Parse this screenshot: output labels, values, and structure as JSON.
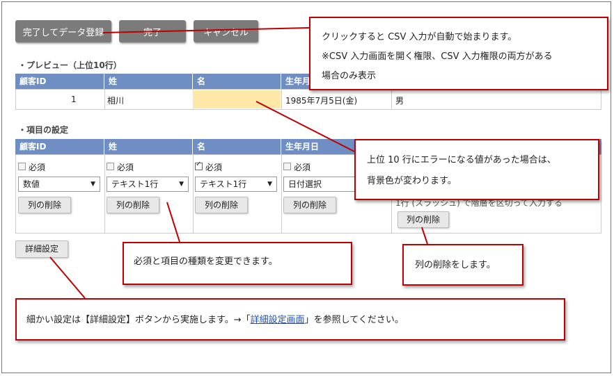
{
  "toolbar": {
    "complete_register_label": "完了してデータ登録",
    "complete_label": "完了",
    "cancel_label": "キャンセル"
  },
  "preview": {
    "title": "・プレビュー（上位10行）",
    "headers": [
      "顧客ID",
      "姓",
      "名",
      "生年月日"
    ],
    "row": [
      "1",
      "相川",
      "",
      "1985年7月5日(金)",
      "男"
    ],
    "error_cell_color": "#fde8a8"
  },
  "settings": {
    "title": "・項目の設定",
    "headers": [
      "顧客ID",
      "姓",
      "名",
      "生年月日"
    ],
    "required_label": "必須",
    "columns": [
      {
        "required": false,
        "type": "数値",
        "delete_label": "列の削除"
      },
      {
        "required": false,
        "type": "テキスト1行",
        "delete_label": "列の削除"
      },
      {
        "required": true,
        "type": "テキスト1行",
        "delete_label": "列の削除"
      },
      {
        "required": false,
        "type": "日付選択",
        "delete_label": "列の削除"
      },
      {
        "partial_text": "1行 (スラッシュ) で階層を区切って入力する",
        "delete_label": "列の削除"
      }
    ],
    "detail_button_label": "詳細設定"
  },
  "callouts": {
    "csv_line1": "クリックすると CSV 入力が自動で始まります。",
    "csv_line2": "※CSV 入力画面を開く権限、CSV 入力権限の両方がある",
    "csv_line3": "場合のみ表示",
    "error_line1": "上位 10 行にエラーになる値があった場合は、",
    "error_line2": "背景色が変わります。",
    "required_text": "必須と項目の種類を変更できます。",
    "delete_text": "列の削除をします。",
    "detail_prefix": "細かい設定は【詳細設定】ボタンから実施します。→「",
    "detail_link": "詳細設定画面",
    "detail_suffix": "」を参照してください。"
  },
  "colors": {
    "header_blue": "#6f8ec3",
    "callout_red": "#c00000",
    "dark_button": "#7b7b7b"
  }
}
